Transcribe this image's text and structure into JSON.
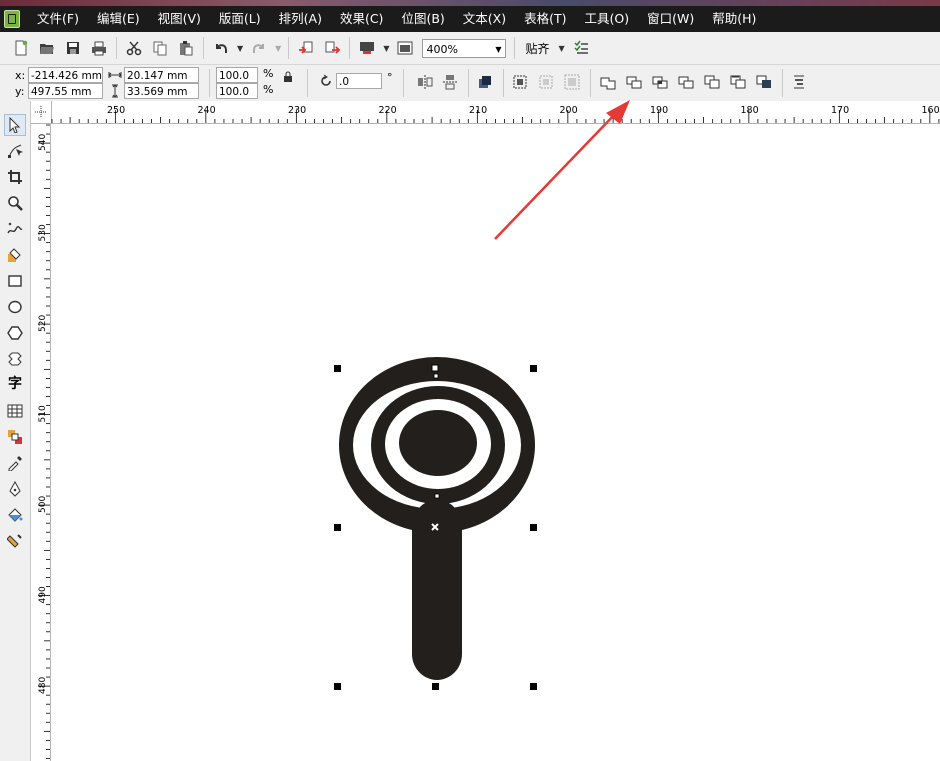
{
  "menu": [
    "文件(F)",
    "编辑(E)",
    "视图(V)",
    "版面(L)",
    "排列(A)",
    "效果(C)",
    "位图(B)",
    "文本(X)",
    "表格(T)",
    "工具(O)",
    "窗口(W)",
    "帮助(H)"
  ],
  "toolbar": {
    "zoom": "400%",
    "snap": "贴齐"
  },
  "property_bar": {
    "x_label": "x:",
    "x_value": "-214.426 mm",
    "y_label": "y:",
    "y_value": "497.55 mm",
    "width_value": "20.147 mm",
    "height_value": "33.569 mm",
    "scale_x": "100.0",
    "scale_y": "100.0",
    "percent": "%",
    "rotation": ".0",
    "degree": "°"
  },
  "ruler": {
    "top_labels": [
      "250",
      "240",
      "230",
      "220",
      "210",
      "200",
      "190",
      "180",
      "170",
      "160"
    ],
    "left_labels": [
      "540",
      "530",
      "520",
      "510",
      "500",
      "490",
      "480"
    ]
  },
  "icons": {
    "arrow_color": "#e53935",
    "shape_color": "#231f1c"
  }
}
